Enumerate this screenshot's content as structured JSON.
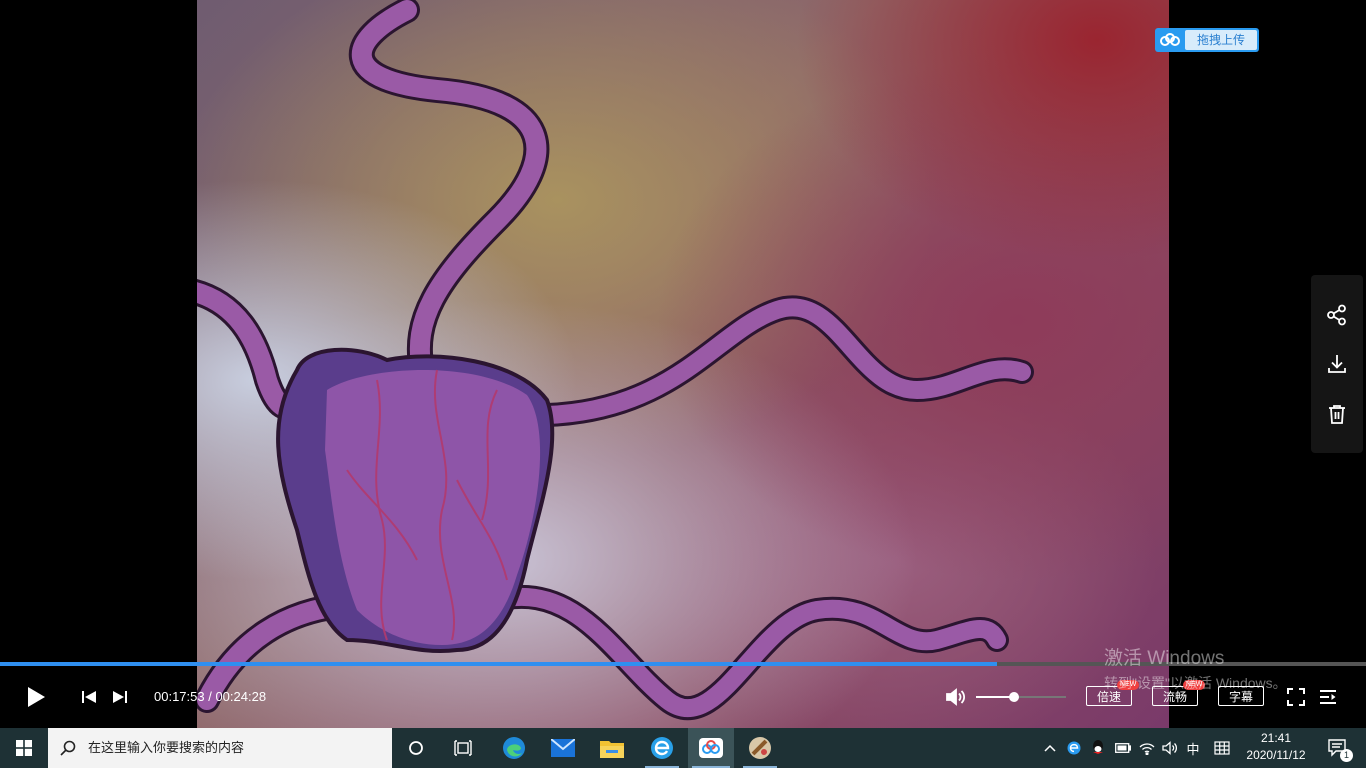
{
  "player": {
    "upload_label": "拖拽上传",
    "time_current": "00:17:53",
    "time_separator": " / ",
    "time_total": "00:24:28",
    "progress_fraction": 0.73,
    "volume_fraction": 0.42,
    "speed_label": "倍速",
    "quality_label": "流畅",
    "subtitle_label": "字幕",
    "new_badge": "NEW",
    "accent_color": "#2f8ff0"
  },
  "side_panel": {
    "icons": [
      "share-icon",
      "download-icon",
      "trash-icon"
    ]
  },
  "watermark": {
    "line1": "激活 Windows",
    "line2": "转到\"设置\"以激活 Windows。"
  },
  "taskbar": {
    "search_placeholder": "在这里输入你要搜索的内容",
    "apps": [
      "cortana-icon",
      "task-view-icon",
      "edge-icon",
      "mail-icon",
      "file-explorer-icon",
      "ie-icon",
      "baidu-netdisk-icon",
      "app-icon"
    ],
    "tray": {
      "ime_label": "中",
      "time": "21:41",
      "date": "2020/11/12",
      "notification_count": "1"
    }
  }
}
